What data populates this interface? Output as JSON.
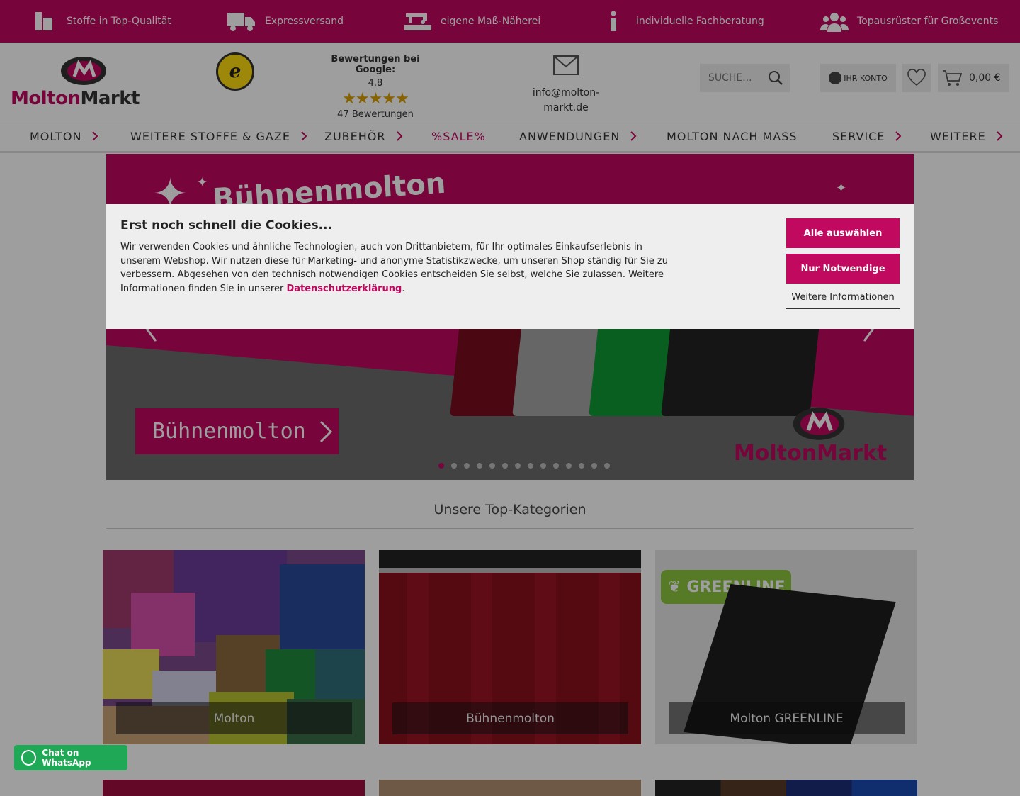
{
  "usp_bar": {
    "items": [
      {
        "label": "Stoffe in Top-Qualität",
        "icon": "fabric-roll-icon"
      },
      {
        "label": "Expressversand",
        "icon": "truck-icon"
      },
      {
        "label": "eigene Maß-Näherei",
        "icon": "sewing-machine-icon"
      },
      {
        "label": "individuelle Fachberatung",
        "icon": "info-icon"
      },
      {
        "label": "Topausrüster für Großevents",
        "icon": "users-icon"
      }
    ]
  },
  "header": {
    "logo_text": "MoltonMarkt",
    "trust_badge": "e",
    "reviews_title": "Bewertungen bei Google:",
    "reviews_rating": "4.8",
    "reviews_count": "47 Bewertungen",
    "email_line1": "info@molton-",
    "email_line2": "markt.de",
    "search_placeholder": "SUCHE...",
    "account_label": "IHR KONTO",
    "cart_total": "0,00 €"
  },
  "nav": {
    "items": [
      {
        "label": "MOLTON",
        "has_arrow": true
      },
      {
        "label": "WEITERE STOFFE & GAZE",
        "has_arrow": true
      },
      {
        "label": "ZUBEHÖR",
        "has_arrow": true
      },
      {
        "label": "%SALE%",
        "has_arrow": false
      },
      {
        "label": "ANWENDUNGEN",
        "has_arrow": true
      },
      {
        "label": "MOLTON NACH MASS",
        "has_arrow": false
      },
      {
        "label": "SERVICE",
        "has_arrow": true
      },
      {
        "label": "WEITERE",
        "has_arrow": true
      }
    ]
  },
  "hero": {
    "headline": "Bühnenmolton",
    "cta_label": "Bühnenmolton",
    "logo_text": "MoltonMarkt",
    "slide_count": 14,
    "active_slide": 1
  },
  "cookie": {
    "title": "Erst noch schnell die Cookies...",
    "text": "Wir verwenden Cookies und ähnliche Technologien, auch von Drittanbietern, für Ihr optimales Einkaufserlebnis in unserem Webshop. Wir nutzen diese für Marketing- und anonyme Statistikzwecke, um unseren Shop ständig für Sie zu verbessern. Abgesehen von den technisch notwendigen Cookies entscheiden Sie selbst, welche Sie zulassen. Weitere Informationen finden Sie in unserer ",
    "link_text": "Datenschutzerklärung",
    "text_end": ".",
    "accept_all": "Alle auswählen",
    "only_necessary": "Nur Notwendige",
    "more_info": "Weitere Informationen"
  },
  "categories": {
    "title": "Unsere Top-Kategorien",
    "items": [
      {
        "label": "Molton"
      },
      {
        "label": "Bühnenmolton"
      },
      {
        "label": "Molton GREENLINE",
        "badge": "GREENLINE"
      }
    ]
  },
  "whatsapp": {
    "label": "Chat on WhatsApp"
  },
  "colors": {
    "brand": "#c0095f",
    "whatsapp": "#1fa855",
    "greenline": "#8dc63f"
  }
}
